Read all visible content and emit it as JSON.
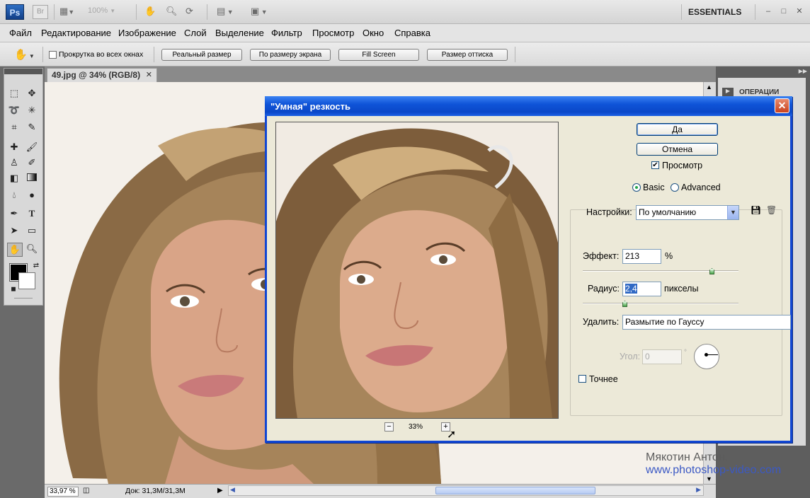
{
  "app": {
    "logo": "Ps",
    "bridge_logo": "Br",
    "zoom_level": "100%",
    "workspace": "ESSENTIALS",
    "minimize": "–",
    "restore": "□",
    "close": "✕"
  },
  "menu": [
    "Файл",
    "Редактирование",
    "Изображение",
    "Слой",
    "Выделение",
    "Фильтр",
    "Просмотр",
    "Окно",
    "Справка"
  ],
  "options": {
    "scroll_all_label": "Прокрутка во всех окнах",
    "btn_actual": "Реальный размер",
    "btn_fit": "По размеру экрана",
    "btn_fill": "Fill Screen",
    "btn_print": "Размер оттиска"
  },
  "document": {
    "tab_title": "49.jpg @ 34% (RGB/8)",
    "status_zoom": "33,97 %",
    "status_doc": "Док: 31,3М/31,3М"
  },
  "right_panel": {
    "operations_label": "ОПЕРАЦИИ"
  },
  "watermark": {
    "author": "Мякотин Антон.",
    "site": "www.photoshop-video.com"
  },
  "dialog": {
    "title": "\"Умная\" резкость",
    "ok_label": "Да",
    "cancel_label": "Отмена",
    "preview_label": "Просмотр",
    "preview_checked": true,
    "mode_basic": "Basic",
    "mode_advanced": "Advanced",
    "mode_selected": "Basic",
    "settings_label": "Настройки:",
    "settings_value": "По умолчанию",
    "effect_label": "Эффект:",
    "effect_value": "213",
    "effect_unit": "%",
    "effect_slider": 0.426,
    "radius_label": "Радиус:",
    "radius_value": "2,4",
    "radius_unit": "пикселы",
    "radius_slider": 0.037,
    "remove_label": "Удалить:",
    "remove_value": "Размытие по Гауссу",
    "angle_label": "Угол:",
    "angle_value": "0",
    "angle_unit": "°",
    "more_accurate_label": "Точнее",
    "more_accurate_checked": false,
    "zoom_minus": "−",
    "zoom_plus": "+",
    "preview_zoom": "33%"
  }
}
